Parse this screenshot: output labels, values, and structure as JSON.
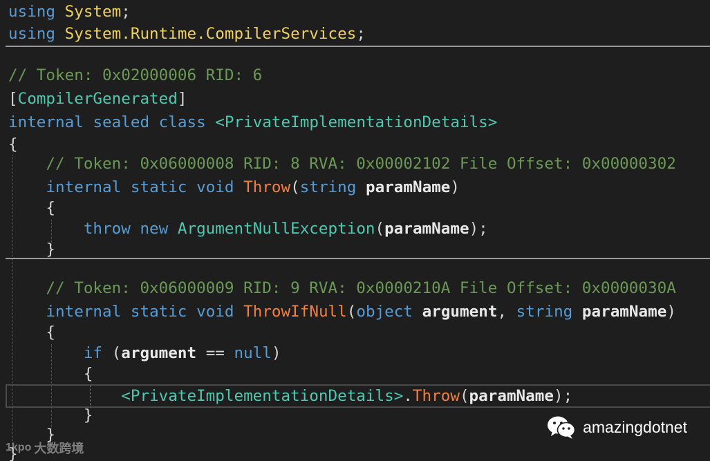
{
  "code": {
    "using_kw": "using",
    "semicolon": ";",
    "ns_system": "System",
    "ns_runtime": "System.Runtime.CompilerServices",
    "comment_class": "// Token: 0x02000006 RID: 6",
    "bracket_open": "[",
    "bracket_close": "]",
    "attr_compiler_generated": "CompilerGenerated",
    "internal_kw": "internal",
    "sealed_kw": "sealed",
    "class_kw": "class",
    "class_name": "<PrivateImplementationDetails>",
    "brace_open": "{",
    "brace_close": "}",
    "comment_throw": "// Token: 0x06000008 RID: 8 RVA: 0x00002102 File Offset: 0x00000302",
    "static_kw": "static",
    "void_kw": "void",
    "throw_method": "Throw",
    "paren_open": "(",
    "paren_close": ")",
    "paren_semicolon": ");",
    "string_kw": "string",
    "param_name": "paramName",
    "throw_kw": "throw",
    "new_kw": "new",
    "argument_null_exception": "ArgumentNullException",
    "comment_throwifnull": "// Token: 0x06000009 RID: 9 RVA: 0x0000210A File Offset: 0x0000030A",
    "throwifnull_method": "ThrowIfNull",
    "object_kw": "object",
    "argument_param": "argument",
    "comma": ",",
    "if_kw": "if",
    "eq_op": "==",
    "null_kw": "null",
    "dot": "."
  },
  "watermark": {
    "text": "amazingdotnet",
    "icon": "wechat-icon"
  },
  "corner_logo": {
    "mark": "1kpo",
    "text": "大数跨境"
  },
  "colors": {
    "background": "#1e1e1e",
    "keyword": "#569cd6",
    "type": "#4ec9b0",
    "comment": "#6a9955",
    "method": "#f08040",
    "namespace": "#f0d060",
    "parameter": "#e8e8e8"
  }
}
